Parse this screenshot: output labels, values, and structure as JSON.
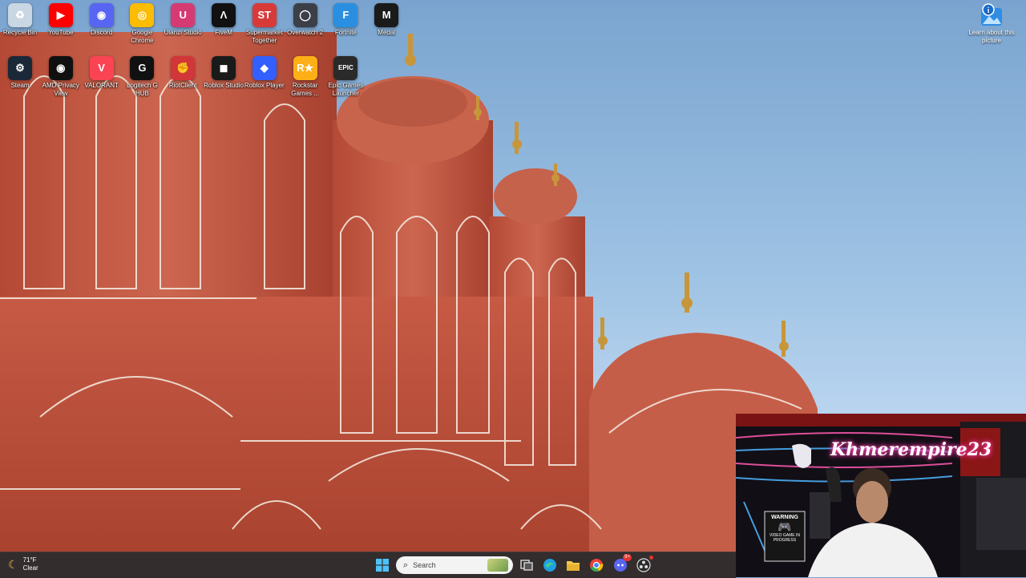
{
  "desktop": {
    "row1": [
      {
        "label": "Recycle Bin",
        "icon": "recycle-bin-icon",
        "color": "#c9d6e3"
      },
      {
        "label": "YouTube",
        "icon": "youtube-icon",
        "color": "#ff0000"
      },
      {
        "label": "Discord",
        "icon": "discord-icon",
        "color": "#5865f2"
      },
      {
        "label": "Google Chrome",
        "icon": "chrome-icon",
        "color": "#fbbc04"
      },
      {
        "label": "Ulanzi Studio",
        "icon": "ulanzi-icon",
        "color": "#d63a73"
      },
      {
        "label": "FiveM",
        "icon": "fivem-icon",
        "color": "#111111"
      },
      {
        "label": "Supermarket Together",
        "icon": "supermarket-icon",
        "color": "#d83a3a"
      },
      {
        "label": "Overwatch 2",
        "icon": "overwatch-icon",
        "color": "#3b3f48"
      },
      {
        "label": "Fortnite",
        "icon": "fortnite-icon",
        "color": "#2a8fe0"
      },
      {
        "label": "Medal",
        "icon": "medal-icon",
        "color": "#1a1a1a"
      }
    ],
    "row2": [
      {
        "label": "Steam",
        "icon": "steam-icon",
        "color": "#1b2838"
      },
      {
        "label": "AMD Privacy View",
        "icon": "amd-privacy-icon",
        "color": "#101010"
      },
      {
        "label": "VALORANT",
        "icon": "valorant-icon",
        "color": "#fa4454"
      },
      {
        "label": "Logitech G HUB",
        "icon": "logitech-icon",
        "color": "#111111"
      },
      {
        "label": "RiotClient",
        "icon": "riot-icon",
        "color": "#d13639"
      },
      {
        "label": "Roblox Studio",
        "icon": "roblox-studio-icon",
        "color": "#1a1a1a"
      },
      {
        "label": "Roblox Player",
        "icon": "roblox-player-icon",
        "color": "#335fff"
      },
      {
        "label": "Rockstar Games ...",
        "icon": "rockstar-icon",
        "color": "#fcaf17"
      },
      {
        "label": "Epic Games Launcher",
        "icon": "epic-games-icon",
        "color": "#2a2a2a"
      }
    ],
    "learn": {
      "label": "Learn about this picture"
    }
  },
  "glyphs": {
    "recycle-bin-icon": "♻",
    "youtube-icon": "▶",
    "discord-icon": "◉",
    "chrome-icon": "◎",
    "ulanzi-icon": "U",
    "fivem-icon": "Λ",
    "supermarket-icon": "ST",
    "overwatch-icon": "◯",
    "fortnite-icon": "F",
    "medal-icon": "M",
    "steam-icon": "⚙",
    "amd-privacy-icon": "◉",
    "valorant-icon": "V",
    "logitech-icon": "G",
    "riot-icon": "✊",
    "roblox-studio-icon": "◼",
    "roblox-player-icon": "◆",
    "rockstar-icon": "R★",
    "epic-games-icon": "EPIC"
  },
  "webcam": {
    "neon_text": "Khmerempire23",
    "sign_title": "WARNING",
    "sign_text": "VIDEO GAME IN PROGRESS"
  },
  "taskbar": {
    "weather_temp": "71°F",
    "weather_desc": "Clear",
    "search_placeholder": "Search",
    "apps": [
      {
        "name": "windows-start-icon",
        "color": "#4cc2ff"
      },
      {
        "name": "task-view-icon",
        "color": "#d0d0d0"
      },
      {
        "name": "edge-icon",
        "color": "#1fa0e3"
      },
      {
        "name": "file-explorer-icon",
        "color": "#f4c74a"
      },
      {
        "name": "chrome-icon",
        "color": "#e94235"
      },
      {
        "name": "discord-icon",
        "color": "#5865f2"
      },
      {
        "name": "obs-icon",
        "color": "#dddddd"
      }
    ],
    "discord_badge": "9+"
  }
}
